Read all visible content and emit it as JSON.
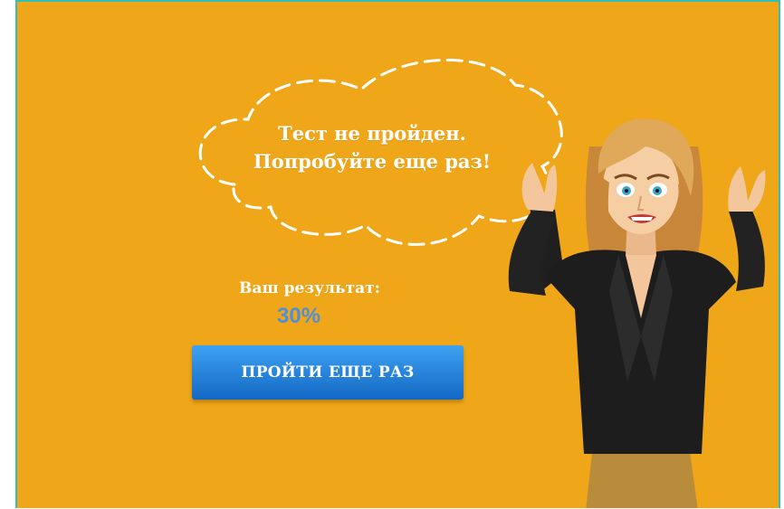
{
  "message": {
    "line1": "Тест не пройден.",
    "line2": "Попробуйте еще раз!"
  },
  "result": {
    "label": "Ваш результат:",
    "value": "30%"
  },
  "retry_button": {
    "label": "ПРОЙТИ ЕЩЕ РАЗ"
  },
  "colors": {
    "background": "#f0a619",
    "frame_border": "#2fc1b6",
    "button_top": "#3ea2f0",
    "button_bottom": "#1368c4",
    "result_value": "#4f8fd8"
  },
  "illustration": "surprised-woman-in-black-suit"
}
